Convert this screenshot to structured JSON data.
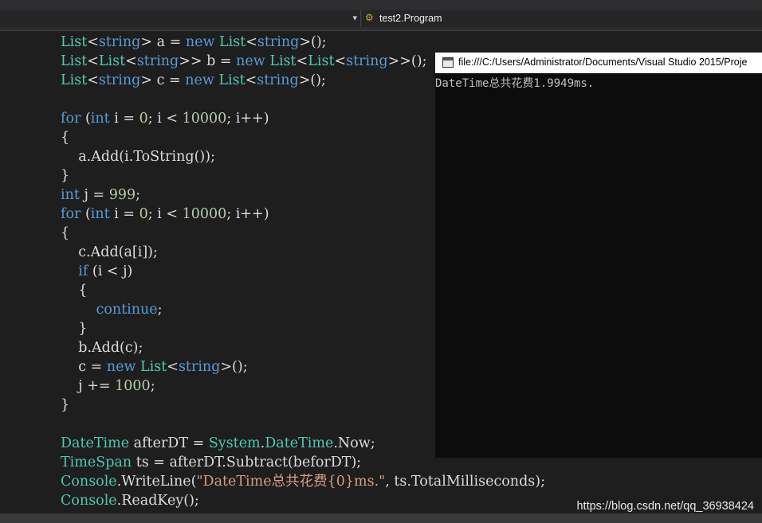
{
  "toolbar": {
    "class_dropdown": "test2.Program"
  },
  "console": {
    "title": "file:///C:/Users/Administrator/Documents/Visual Studio 2015/Proje",
    "output": "DateTime总共花费1.9949ms."
  },
  "code": [
    [
      [
        "ty",
        "List"
      ],
      [
        "",
        "<"
      ],
      [
        "kw",
        "string"
      ],
      [
        "",
        "> a = "
      ],
      [
        "kw",
        "new"
      ],
      [
        "",
        "",
        " "
      ],
      [
        "ty",
        "List"
      ],
      [
        "",
        "<"
      ],
      [
        "kw",
        "string"
      ],
      [
        "",
        ">();"
      ]
    ],
    [
      [
        "ty",
        "List"
      ],
      [
        "",
        "<"
      ],
      [
        "ty",
        "List"
      ],
      [
        "",
        "<"
      ],
      [
        "kw",
        "string"
      ],
      [
        "",
        ">> b = "
      ],
      [
        "kw",
        "new"
      ],
      [
        "",
        "",
        " "
      ],
      [
        "ty",
        "List"
      ],
      [
        "",
        "<"
      ],
      [
        "ty",
        "List"
      ],
      [
        "",
        "<"
      ],
      [
        "kw",
        "string"
      ],
      [
        "",
        ">>();"
      ]
    ],
    [
      [
        "ty",
        "List"
      ],
      [
        "",
        "<"
      ],
      [
        "kw",
        "string"
      ],
      [
        "",
        "> c = "
      ],
      [
        "kw",
        "new"
      ],
      [
        "",
        "",
        " "
      ],
      [
        "ty",
        "List"
      ],
      [
        "",
        "<"
      ],
      [
        "kw",
        "string"
      ],
      [
        "",
        ">();"
      ]
    ],
    [],
    [
      [
        "kw",
        "for"
      ],
      [
        "",
        "",
        " ("
      ],
      [
        "kw",
        "int"
      ],
      [
        "",
        "",
        " i = "
      ],
      [
        "num",
        "0"
      ],
      [
        "",
        "; i < "
      ],
      [
        "num",
        "10000"
      ],
      [
        "",
        "; i++)"
      ]
    ],
    [
      [
        "",
        "{"
      ]
    ],
    [
      [
        "",
        "    a.Add(i.ToString());"
      ]
    ],
    [
      [
        "",
        "}"
      ]
    ],
    [
      [
        "kw",
        "int"
      ],
      [
        "",
        "",
        " j = "
      ],
      [
        "num",
        "999"
      ],
      [
        "",
        ";"
      ]
    ],
    [
      [
        "kw",
        "for"
      ],
      [
        "",
        "",
        " ("
      ],
      [
        "kw",
        "int"
      ],
      [
        "",
        "",
        " i = "
      ],
      [
        "num",
        "0"
      ],
      [
        "",
        "; i < "
      ],
      [
        "num",
        "10000"
      ],
      [
        "",
        "; i++)"
      ]
    ],
    [
      [
        "",
        "{"
      ]
    ],
    [
      [
        "",
        "    c.Add(a[i]);"
      ]
    ],
    [
      [
        "",
        "    "
      ],
      [
        "kw",
        "if"
      ],
      [
        "",
        "",
        " (i < j)"
      ]
    ],
    [
      [
        "",
        "    {"
      ]
    ],
    [
      [
        "",
        "        "
      ],
      [
        "kw",
        "continue"
      ],
      [
        "",
        ";"
      ]
    ],
    [
      [
        "",
        "    }"
      ]
    ],
    [
      [
        "",
        "    b.Add(c);"
      ]
    ],
    [
      [
        "",
        "    c = "
      ],
      [
        "kw",
        "new"
      ],
      [
        "",
        "",
        " "
      ],
      [
        "ty",
        "List"
      ],
      [
        "",
        "<"
      ],
      [
        "kw",
        "string"
      ],
      [
        "",
        ">();"
      ]
    ],
    [
      [
        "",
        "    j += "
      ],
      [
        "num",
        "1000"
      ],
      [
        "",
        ";"
      ]
    ],
    [
      [
        "",
        "}"
      ]
    ],
    [],
    [
      [
        "ty",
        "DateTime"
      ],
      [
        "",
        "",
        " afterDT = "
      ],
      [
        "ty",
        "System"
      ],
      [
        "",
        "."
      ],
      [
        "ty",
        "DateTime"
      ],
      [
        "",
        ".Now;"
      ]
    ],
    [
      [
        "ty",
        "TimeSpan"
      ],
      [
        "",
        "",
        " ts = afterDT.Subtract(beforDT);"
      ]
    ],
    [
      [
        "ty",
        "Console"
      ],
      [
        "",
        "."
      ],
      [
        "",
        "WriteLine("
      ],
      [
        "str",
        "\"DateTime总共花费{0}ms.\""
      ],
      [
        "",
        ", ts.TotalMilliseconds);"
      ]
    ],
    [
      [
        "ty",
        "Console"
      ],
      [
        "",
        ".ReadKey();"
      ]
    ]
  ],
  "watermark": "https://blog.csdn.net/qq_36938424"
}
